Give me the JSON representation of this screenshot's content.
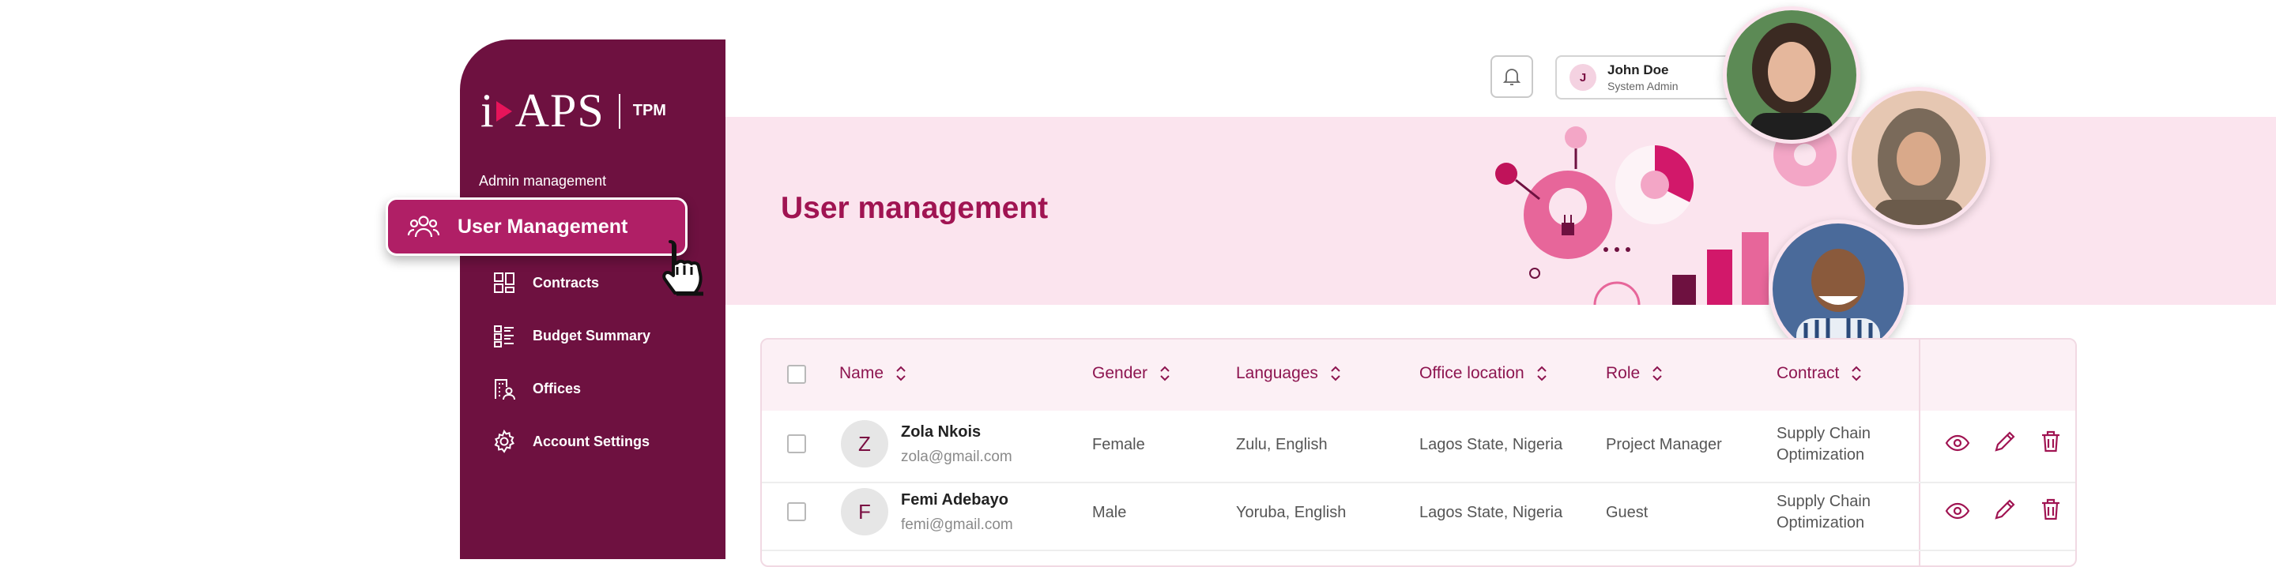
{
  "app": {
    "logo_text": "iAPS",
    "logo_suffix": "TPM"
  },
  "sidebar": {
    "section_label": "Admin management",
    "active_item": {
      "label": "User Management",
      "icon": "users-icon"
    },
    "items": [
      {
        "label": "Contracts",
        "icon": "layout-icon"
      },
      {
        "label": "Budget Summary",
        "icon": "list-icon"
      },
      {
        "label": "Offices",
        "icon": "office-user-icon"
      },
      {
        "label": "Account Settings",
        "icon": "gear-icon"
      }
    ]
  },
  "header": {
    "notification_icon": "bell-icon",
    "user": {
      "initial": "J",
      "name": "John Doe",
      "role": "System Admin"
    }
  },
  "page": {
    "title": "User management"
  },
  "table": {
    "columns": [
      "Name",
      "Gender",
      "Languages",
      "Office location",
      "Role",
      "Contract"
    ],
    "rows": [
      {
        "initial": "Z",
        "name": "Zola Nkois",
        "email": "zola@gmail.com",
        "gender": "Female",
        "languages": "Zulu, English",
        "office": "Lagos State, Nigeria",
        "role": "Project Manager",
        "contract_line1": "Supply Chain",
        "contract_line2": "Optimization"
      },
      {
        "initial": "F",
        "name": "Femi Adebayo",
        "email": "femi@gmail.com",
        "gender": "Male",
        "languages": "Yoruba, English",
        "office": "Lagos State, Nigeria",
        "role": "Guest",
        "contract_line1": "Supply Chain",
        "contract_line2": "Optimization"
      }
    ],
    "action_icons": [
      "eye-icon",
      "pencil-icon",
      "trash-icon"
    ]
  },
  "colors": {
    "sidebar": "#6e1140",
    "accent": "#b01f66",
    "banner": "#fbe4ee",
    "title": "#a01452"
  }
}
